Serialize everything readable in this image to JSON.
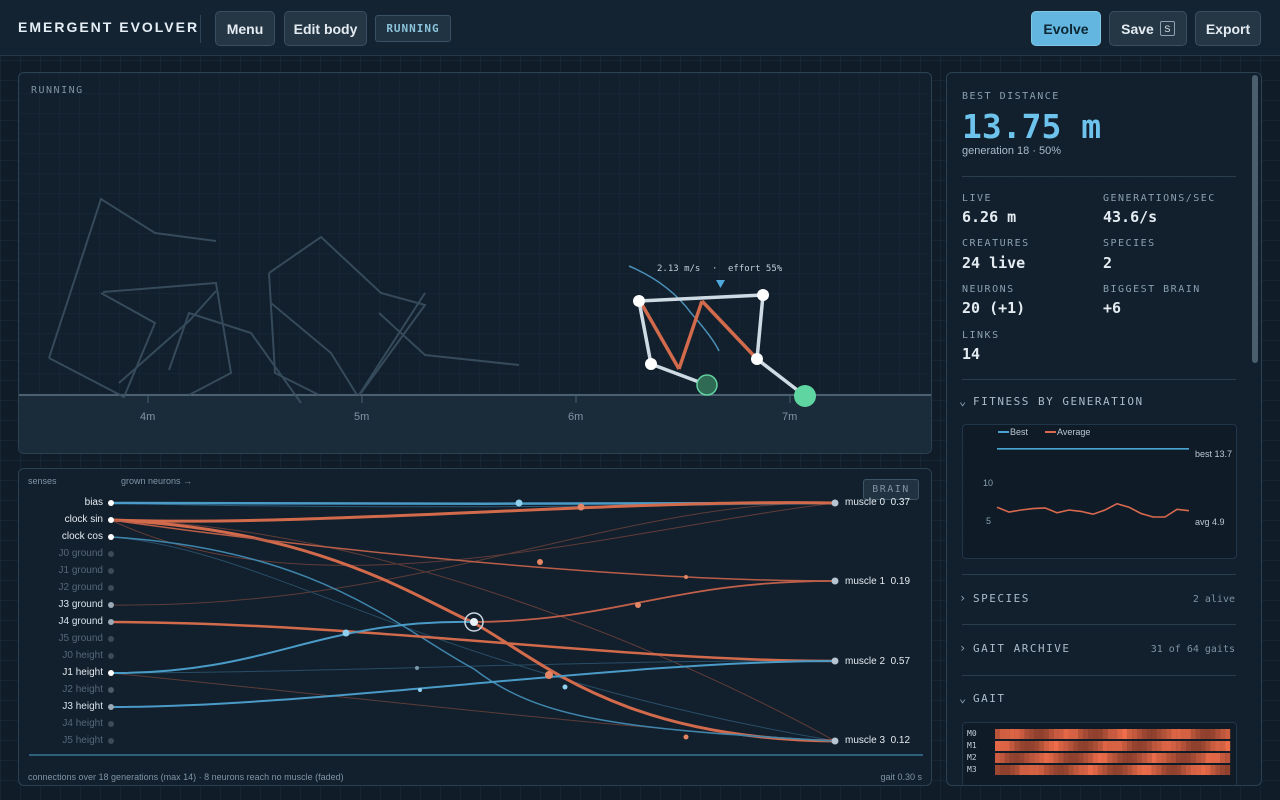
{
  "app": {
    "title": "EMERGENT EVOLVER",
    "menu_label": "Menu",
    "edit_body_label": "Edit body",
    "status_pill": "RUNNING",
    "evolve_label": "Evolve",
    "save_label": "Save",
    "save_key": "S",
    "export_label": "Export"
  },
  "sim": {
    "label": "RUNNING",
    "speed": "2.13 m/s",
    "effort": "effort 55%",
    "distance_ticks": [
      "4m",
      "5m",
      "6m",
      "7m"
    ]
  },
  "brain": {
    "senses_label": "senses",
    "grown_label": "grown neurons →",
    "badge": "BRAIN",
    "inputs": [
      "bias",
      "clock sin",
      "clock cos",
      "J0 ground",
      "J1 ground",
      "J2 ground",
      "J3 ground",
      "J4 ground",
      "J5 ground",
      "J0 height",
      "J1 height",
      "J2 height",
      "J3 height",
      "J4 height",
      "J5 height"
    ],
    "outputs": [
      {
        "name": "muscle 0",
        "value": "0.37"
      },
      {
        "name": "muscle 1",
        "value": "0.19"
      },
      {
        "name": "muscle 2",
        "value": "0.57"
      },
      {
        "name": "muscle 3",
        "value": "0.12"
      }
    ],
    "footer_left": "connections over 18 generations (max 14)  ·  8 neurons reach no muscle (faded)",
    "footer_right": "gait 0.30 s"
  },
  "stats": {
    "best_label": "BEST DISTANCE",
    "best_value": "13.75 m",
    "best_sub": "generation 18 · 50%",
    "live_label": "LIVE",
    "live_value": "6.26 m",
    "gps_label": "GENERATIONS/SEC",
    "gps_value": "43.6/s",
    "creatures_label": "CREATURES",
    "creatures_value": "24 live",
    "species_label": "SPECIES",
    "species_value": "2",
    "neurons_label": "NEURONS",
    "neurons_value": "20 (+1)",
    "biggest_label": "BIGGEST BRAIN",
    "biggest_value": "+6",
    "links_label": "LINKS",
    "links_value": "14"
  },
  "sections": {
    "fitness": "FITNESS BY GENERATION",
    "species": "SPECIES",
    "species_right": "2 alive",
    "gait_archive": "GAIT ARCHIVE",
    "gait_archive_right": "31 of 64 gaits",
    "gait": "GAIT",
    "gait_rows": [
      "M0",
      "M1",
      "M2",
      "M3"
    ]
  },
  "chart_data": {
    "type": "line",
    "title": "",
    "legend": [
      "Best",
      "Average"
    ],
    "ytick_labels": [
      "10",
      "5"
    ],
    "series": [
      {
        "name": "Best",
        "values": [
          13.75,
          13.75,
          13.75,
          13.75,
          13.75,
          13.75,
          13.75,
          13.75,
          13.75,
          13.75,
          13.75,
          13.75,
          13.75,
          13.75,
          13.75,
          13.75,
          13.75,
          13.75
        ]
      },
      {
        "name": "Average",
        "values": [
          5.4,
          4.7,
          5.0,
          5.2,
          5.3,
          4.6,
          5.0,
          4.8,
          4.4,
          5.0,
          5.9,
          5.4,
          4.5,
          4.0,
          4.0,
          5.1,
          4.9
        ]
      }
    ],
    "best_annotation": "best 13.7",
    "avg_annotation": "avg 4.9",
    "ylim": [
      0,
      16
    ],
    "colors": {
      "best": "#4aa3d1",
      "average": "#d9694e"
    }
  }
}
